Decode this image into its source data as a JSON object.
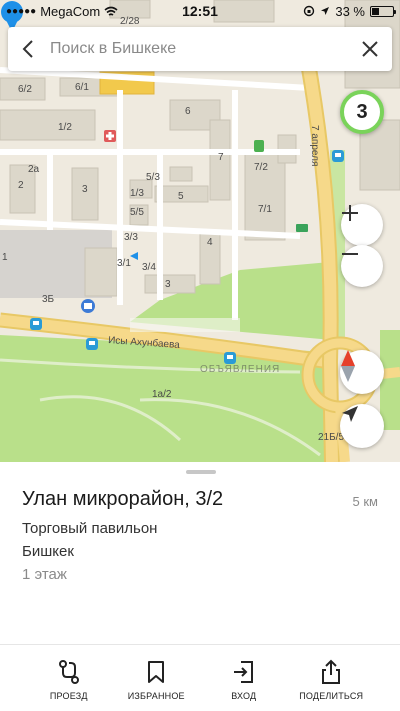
{
  "status_bar": {
    "carrier": "MegaCom",
    "time": "12:51",
    "battery_text": "33 %",
    "battery_level": 0.33
  },
  "search": {
    "placeholder": "Поиск в Бишкеке"
  },
  "map": {
    "traffic_level": "3",
    "traffic_color": "#7ad35a",
    "labels": {
      "street_isy": "Исы Ахунбаева",
      "street_7apr": "7 апреля",
      "watermark": "ОБЪЯВЛЕНИЯ",
      "b_6": "6",
      "b_6_2": "6/2",
      "b_6_1": "6/1",
      "b_1_2": "1/2",
      "b_2a": "2а",
      "b_2": "2",
      "b_3": "3",
      "b_3_1": "3/1",
      "b_3_3": "3/3",
      "b_3_4": "3/4",
      "b_3b": "3Б",
      "b_1": "1",
      "b_1_3": "1/3",
      "b_5_5": "5/5",
      "b_5_3": "5/3",
      "b_5": "5",
      "b_4": "4",
      "b_7": "7",
      "b_7_2": "7/2",
      "b_7_1": "7/1",
      "b_3_right": "3",
      "b_1a_2": "1а/2",
      "b_21b_5": "21Б/5",
      "b_2_28": "2/28"
    }
  },
  "place": {
    "title": "Улан микрорайон, 3/2",
    "distance": "5 км",
    "category": "Торговый павильон",
    "city": "Бишкек",
    "floor": "1 этаж"
  },
  "actions": [
    {
      "icon": "route-icon",
      "label": "ПРОЕЗД"
    },
    {
      "icon": "bookmark-icon",
      "label": "ИЗБРАННОЕ"
    },
    {
      "icon": "entrance-icon",
      "label": "ВХОД"
    },
    {
      "icon": "share-icon",
      "label": "ПОДЕЛИТЬСЯ"
    }
  ],
  "colors": {
    "map_bg": "#efeadf",
    "building": "#dcd7ca",
    "road_major": "#f6d98a",
    "green": "#b9e08a",
    "pin": "#1e90e8"
  }
}
